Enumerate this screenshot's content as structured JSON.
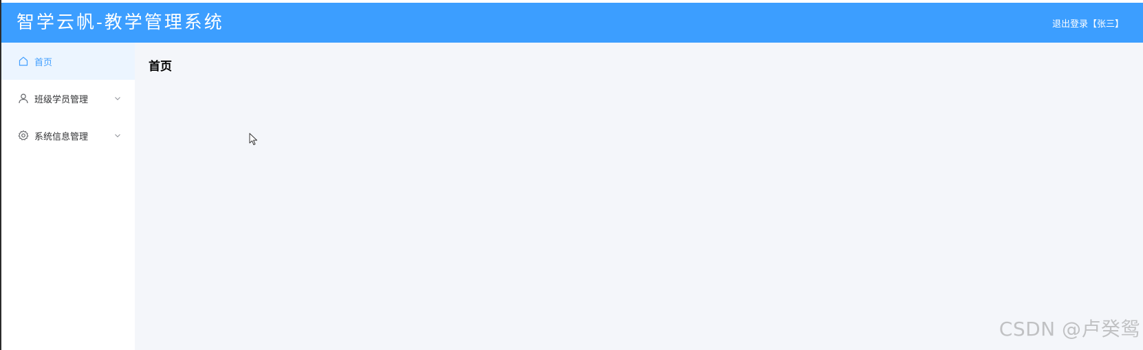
{
  "header": {
    "app_title": "智学云帆-教学管理系统",
    "logout_label": "退出登录",
    "user_display": "【张三】",
    "background_color": "#3c9eff"
  },
  "sidebar": {
    "items": [
      {
        "label": "首页",
        "icon": "home-icon",
        "active": true,
        "expandable": false
      },
      {
        "label": "班级学员管理",
        "icon": "user-icon",
        "active": false,
        "expandable": true
      },
      {
        "label": "系统信息管理",
        "icon": "gear-icon",
        "active": false,
        "expandable": true
      }
    ],
    "active_color": "#409eff",
    "active_background": "#ecf5ff"
  },
  "main": {
    "page_title": "首页",
    "background_color": "#f4f6fa"
  },
  "watermark": {
    "text": "CSDN @卢癸鸳"
  }
}
